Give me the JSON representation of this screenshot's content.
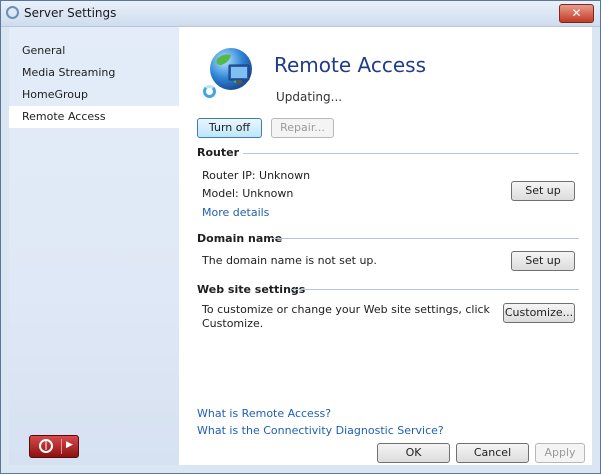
{
  "window": {
    "title": "Server Settings",
    "close_label": "✕"
  },
  "sidebar": {
    "items": [
      {
        "label": "General"
      },
      {
        "label": "Media Streaming"
      },
      {
        "label": "HomeGroup"
      },
      {
        "label": "Remote Access",
        "selected": true
      }
    ],
    "power_icon": "power-icon"
  },
  "main": {
    "title": "Remote Access",
    "status": "Updating...",
    "turn_off_label": "Turn off",
    "repair_label": "Repair...",
    "router": {
      "heading": "Router",
      "ip": "Router IP: Unknown",
      "model": "Model: Unknown",
      "more_details": "More details",
      "setup_label": "Set up"
    },
    "domain": {
      "heading": "Domain name",
      "text": "The domain name is not set up.",
      "setup_label": "Set up"
    },
    "website": {
      "heading": "Web site settings",
      "text_line1": "To customize or change your Web site settings, click",
      "text_line2": "Customize.",
      "customize_label": "Customize..."
    },
    "links": {
      "what_is": "What is Remote Access?",
      "diagnostic": "What is the Connectivity Diagnostic Service?"
    }
  },
  "footer": {
    "ok": "OK",
    "cancel": "Cancel",
    "apply": "Apply"
  },
  "colors": {
    "title_blue": "#1f3c8c",
    "link_blue": "#1f5fb3",
    "sidebar_bg": "#e3ecf8",
    "power_red": "#b01e1e"
  }
}
